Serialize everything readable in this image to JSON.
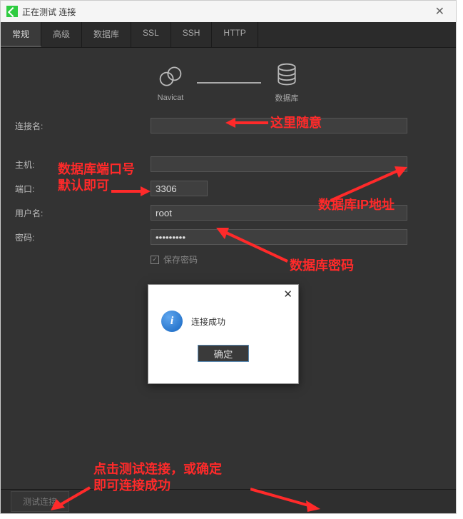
{
  "window": {
    "title": "正在测试                      连接"
  },
  "tabs": [
    "常规",
    "高级",
    "数据库",
    "SSL",
    "SSH",
    "HTTP"
  ],
  "diagram": {
    "left_label": "Navicat",
    "right_label": "数据库"
  },
  "labels": {
    "conn_name": "连接名:",
    "host": "主机:",
    "port": "端口:",
    "user": "用户名:",
    "password": "密码:",
    "save_password": "保存密码"
  },
  "values": {
    "conn_name": "",
    "host": "",
    "port": "3306",
    "user": "root",
    "password": "•••••••••"
  },
  "checkbox_check": "✓",
  "dialog": {
    "close": "✕",
    "info_glyph": "i",
    "message": "连接成功",
    "ok_label": "确定"
  },
  "footer": {
    "test_btn": "测试连接"
  },
  "annotations": {
    "a1": "这里随意",
    "a2_line1": "数据库端口号",
    "a2_line2": "默认即可",
    "a3": "数据库IP地址",
    "a4": "数据库密码",
    "a5_line1": "点击测试连接，或确定",
    "a5_line2": "即可连接成功"
  }
}
